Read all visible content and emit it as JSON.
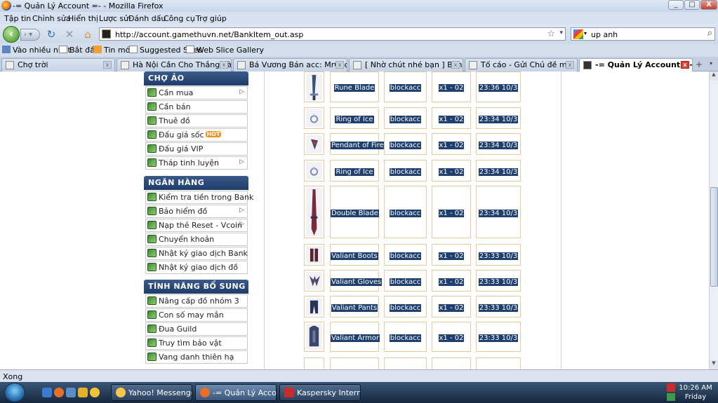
{
  "window": {
    "title": "-= Quản Lý Account =- - Mozilla Firefox",
    "minimize": "_",
    "maximize": "□",
    "close": "X"
  },
  "menu": [
    "Tập tin",
    "Chỉnh sửa",
    "Hiển thị",
    "Lược sử",
    "Đánh dấu",
    "Công cụ",
    "Trợ giúp"
  ],
  "nav": {
    "url": "http://account.gamethuvn.net/BankItem_out.asp",
    "search": "up anh"
  },
  "bookmarks": [
    "Vào nhiều nhất",
    "Bắt đầu",
    "Tin mới",
    "Suggested Sites",
    "Web Slice Gallery"
  ],
  "tabs": [
    {
      "label": "Chợ trời"
    },
    {
      "label": "Hà Nội Cần Cho Thắng này đi..."
    },
    {
      "label": "Bá Vương Bán acc: MrCooL ( ..."
    },
    {
      "label": "[ Nhờ chút nhé bạn ] Bán đấu..."
    },
    {
      "label": "Tố cáo - Gửi Chủ đề mới"
    },
    {
      "label": "-= Quản Lý Account =-"
    }
  ],
  "sidebar": {
    "sections": [
      {
        "title": "CHỢ ẢO",
        "items": [
          {
            "label": "Cần mua",
            "arrow": true
          },
          {
            "label": "Cần bán",
            "arrow": false
          },
          {
            "label": "Thuê đồ",
            "arrow": false
          },
          {
            "label": "Đấu giá sốc",
            "arrow": false,
            "badge": "HOT"
          },
          {
            "label": "Đấu giá VIP",
            "arrow": false
          },
          {
            "label": "Tháp tinh luyện",
            "arrow": true
          }
        ]
      },
      {
        "title": "NGÂN HÀNG",
        "items": [
          {
            "label": "Kiểm tra tiền trong Bank",
            "arrow": false
          },
          {
            "label": "Bảo hiểm đồ",
            "arrow": true
          },
          {
            "label": "Nạp thẻ Reset - Vcoin",
            "arrow": true
          },
          {
            "label": "Chuyển khoản",
            "arrow": false
          },
          {
            "label": "Nhật ký giao dịch Bank",
            "arrow": false
          },
          {
            "label": "Nhật ký giao dịch đồ",
            "arrow": false
          }
        ]
      },
      {
        "title": "TÍNH NĂNG BỔ SUNG",
        "items": [
          {
            "label": "Nâng cấp đồ nhóm 3",
            "arrow": false
          },
          {
            "label": "Con số may mắn",
            "arrow": false
          },
          {
            "label": "Đua Guild",
            "arrow": false
          },
          {
            "label": "Truy tìm bảo vật",
            "arrow": false
          },
          {
            "label": "Vang danh thiên hạ",
            "arrow": false
          }
        ]
      }
    ]
  },
  "items": [
    {
      "name": "Rune Blade",
      "owner": "blockacc",
      "qty": "x1 - 02",
      "time": "23:36 10/3",
      "icon": "sword-icon"
    },
    {
      "name": "Ring of Ice",
      "owner": "blockacc",
      "qty": "x1 - 02",
      "time": "23:34 10/3",
      "icon": "ring-icon"
    },
    {
      "name": "Pendant of Fire",
      "owner": "blockacc",
      "qty": "x1 - 02",
      "time": "23:34 10/3",
      "icon": "pendant-icon"
    },
    {
      "name": "Ring of Ice",
      "owner": "blockacc",
      "qty": "x1 - 02",
      "time": "23:34 10/3",
      "icon": "ring-icon"
    },
    {
      "name": "Double Blade",
      "owner": "blockacc",
      "qty": "x1 - 02",
      "time": "23:34 10/3",
      "icon": "blade-icon"
    },
    {
      "name": "Valiant Boots",
      "owner": "blockacc",
      "qty": "x1 - 02",
      "time": "23:33 10/3",
      "icon": "boots-icon"
    },
    {
      "name": "Valiant Gloves",
      "owner": "blockacc",
      "qty": "x1 - 02",
      "time": "23:33 10/3",
      "icon": "gloves-icon"
    },
    {
      "name": "Valiant Pants",
      "owner": "blockacc",
      "qty": "x1 - 02",
      "time": "23:33 10/3",
      "icon": "pants-icon"
    },
    {
      "name": "Valiant Armor",
      "owner": "blockacc",
      "qty": "x1 - 02",
      "time": "23:33 10/3",
      "icon": "armor-icon"
    }
  ],
  "status": "Xong",
  "taskbar": {
    "tasks": [
      "Yahoo! Messenger",
      "-= Quản Lý Acco...",
      "Kaspersky Interne..."
    ],
    "time": "10:26 AM",
    "day": "Friday"
  }
}
